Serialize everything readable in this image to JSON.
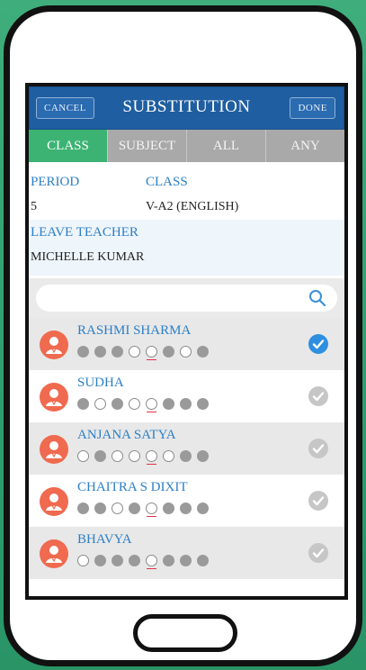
{
  "header": {
    "cancel_label": "Cancel",
    "title": "SUBSTITUTION",
    "done_label": "Done"
  },
  "tabs": [
    {
      "label": "CLASS",
      "active": true
    },
    {
      "label": "SUBJECT",
      "active": false
    },
    {
      "label": "ALL",
      "active": false
    },
    {
      "label": "ANY",
      "active": false
    }
  ],
  "info": {
    "period_label": "PERIOD",
    "period_value": "5",
    "class_label": "CLASS",
    "class_value": "V-A2 (ENGLISH)",
    "leave_teacher_label": "LEAVE TEACHER",
    "leave_teacher_value": "MICHELLE KUMAR"
  },
  "search": {
    "placeholder": "",
    "icon": "search-icon"
  },
  "teachers": [
    {
      "name": "RASHMI SHARMA",
      "slots": [
        1,
        1,
        1,
        0,
        0,
        1,
        0,
        1
      ],
      "selected": true
    },
    {
      "name": "SUDHA",
      "slots": [
        1,
        0,
        1,
        0,
        0,
        1,
        1,
        1
      ],
      "selected": false
    },
    {
      "name": "ANJANA SATYA",
      "slots": [
        0,
        1,
        0,
        0,
        0,
        0,
        1,
        1
      ],
      "selected": false
    },
    {
      "name": "CHAITRA S DIXIT",
      "slots": [
        1,
        1,
        0,
        1,
        0,
        1,
        1,
        1
      ],
      "selected": false
    },
    {
      "name": "BHAVYA",
      "slots": [
        0,
        1,
        1,
        1,
        0,
        1,
        1,
        1
      ],
      "selected": false
    }
  ],
  "current_period_index": 4,
  "colors": {
    "header": "#1f5ea1",
    "active_tab": "#3cb373",
    "accent": "#2c7fc6",
    "avatar": "#f06a4f",
    "check_selected": "#2e8fe0"
  }
}
